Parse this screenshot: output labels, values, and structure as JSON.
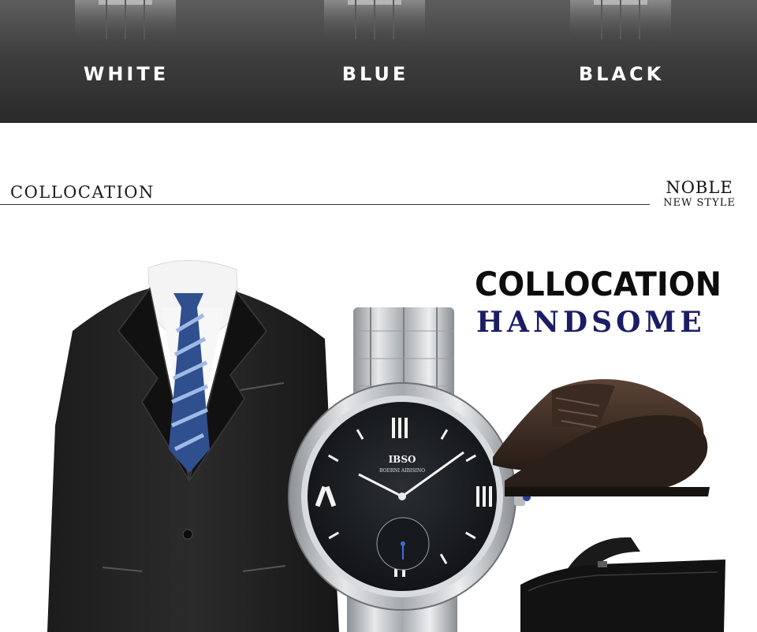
{
  "variants": [
    {
      "label": "WHITE"
    },
    {
      "label": "BLUE"
    },
    {
      "label": "BLACK"
    }
  ],
  "section": {
    "title": "COLLOCATION",
    "badge_line1": "NOBLE",
    "badge_line2": "NEW STYLE"
  },
  "hero": {
    "headline": "COLLOCATION",
    "subheadline": "HANDSOME",
    "watch_brand": "IBSO",
    "watch_subbrand": "BOERNI AIBISINO"
  },
  "colors": {
    "banner_dark": "#2a2a2a",
    "headline_navy": "#1c1c66",
    "watch_dial": "#1b1e22",
    "steel": "#c8cbce"
  },
  "icons": {
    "suit": "suit-image",
    "watch": "watch-image",
    "shoes": "shoes-image",
    "bag": "bag-image"
  }
}
